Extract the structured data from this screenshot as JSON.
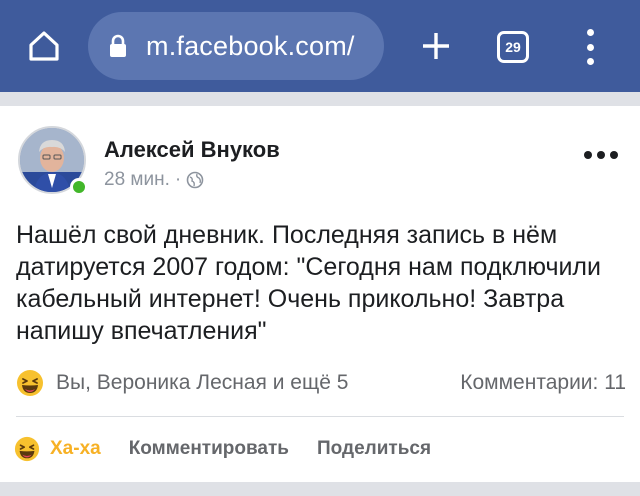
{
  "browser": {
    "url": "m.facebook.com/",
    "tab_count": "29",
    "bar_color": "#3f5b9c"
  },
  "post": {
    "author": "Алексей Внуков",
    "time": "28 мин.",
    "separator": "·",
    "privacy_icon": "globe-icon",
    "text": "Нашёл свой дневник. Последняя запись в нём датируется 2007 годом: \"Сегодня нам подключили кабельный интернет! Очень прикольно! Завтра напишу впечатления\"",
    "reactions": {
      "emoji": "haha-emoji",
      "reactors": "Вы, Вероника Лесная и ещё 5",
      "comments": "Комментарии: 11"
    },
    "actions": {
      "reaction_label": "Ха-ха",
      "comment_label": "Комментировать",
      "share_label": "Поделиться"
    },
    "online_color": "#42b72a",
    "reaction_color": "#f7b125"
  }
}
